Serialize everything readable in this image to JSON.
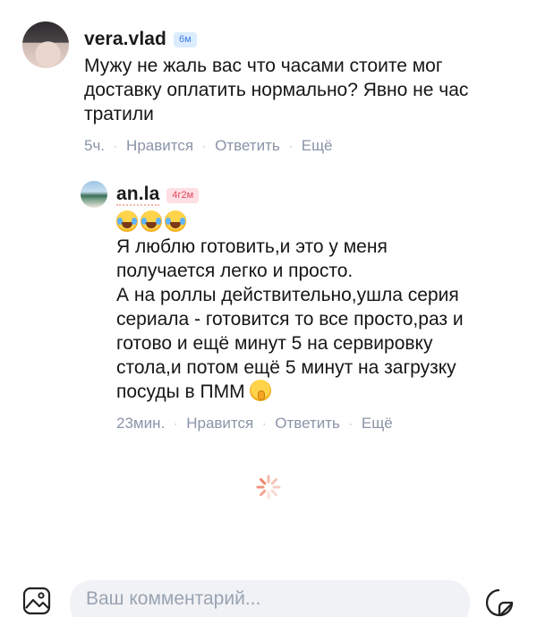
{
  "comments": [
    {
      "author": "vera.vlad",
      "badge": "6м",
      "text": "Мужу не жаль вас что часами стоите мог\nдоставку оплатить нормально? Явно не час\nтратили",
      "time": "5ч.",
      "like_label": "Нравится",
      "reply_label": "Ответить",
      "more_label": "Ещё"
    },
    {
      "author": "an.la",
      "badge": "4г2м",
      "emojis": [
        "face-with-tears-of-joy",
        "face-with-tears-of-joy",
        "face-with-tears-of-joy"
      ],
      "text": "Я люблю готовить,и это у меня\nполучается легко и просто.\nА на роллы действительно,ушла серия\nсериала - готовится то все просто,раз и\nготово  и ещё минут 5 на сервировку\nстола,и потом ещё 5 минут на загрузку\nпосуды в ПММ ",
      "trailing_emoji": "shushing-face",
      "time": "23мин.",
      "like_label": "Нравится",
      "reply_label": "Ответить",
      "more_label": "Ещё"
    }
  ],
  "separator": "·",
  "composer": {
    "placeholder": "Ваш комментарий..."
  },
  "icons": {
    "media": "image-icon",
    "sticker": "sticker-icon",
    "loading": "loading-spinner-icon"
  },
  "colors": {
    "action_text": "#8a94a8",
    "badge_blue_bg": "#dcecff",
    "badge_blue_text": "#3d7fe0",
    "badge_pink_bg": "#ffdfe3",
    "badge_pink_text": "#e14a5e",
    "composer_bg": "#f0f2f5"
  }
}
